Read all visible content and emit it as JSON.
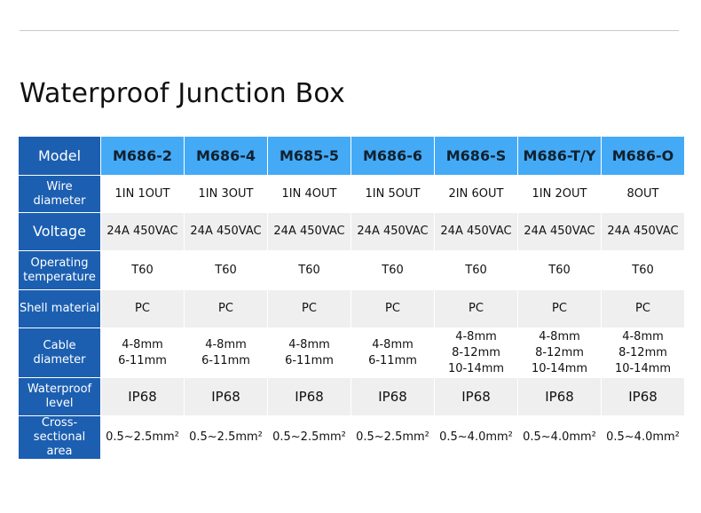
{
  "title": "Waterproof Junction Box",
  "table": {
    "header_label": "Model",
    "models": [
      "M686-2",
      "M686-4",
      "M685-5",
      "M686-6",
      "M686-S",
      "M686-T/Y",
      "M686-O"
    ],
    "rows": [
      {
        "label": [
          "Wire",
          "diameter"
        ],
        "style": "wht",
        "size": "normal",
        "cells": [
          [
            "1IN 1OUT"
          ],
          [
            "1IN 3OUT"
          ],
          [
            "1IN 4OUT"
          ],
          [
            "1IN 5OUT"
          ],
          [
            "2IN 6OUT"
          ],
          [
            "1IN 2OUT"
          ],
          [
            "8OUT"
          ]
        ]
      },
      {
        "label": [
          "Voltage"
        ],
        "style": "alt",
        "size": "normal",
        "big": true,
        "cells": [
          [
            "24A 450VAC"
          ],
          [
            "24A 450VAC"
          ],
          [
            "24A 450VAC"
          ],
          [
            "24A 450VAC"
          ],
          [
            "24A 450VAC"
          ],
          [
            "24A 450VAC"
          ],
          [
            "24A 450VAC"
          ]
        ]
      },
      {
        "label": [
          "Operating",
          "temperature"
        ],
        "style": "wht",
        "size": "normal",
        "cells": [
          [
            "T60"
          ],
          [
            "T60"
          ],
          [
            "T60"
          ],
          [
            "T60"
          ],
          [
            "T60"
          ],
          [
            "T60"
          ],
          [
            "T60"
          ]
        ]
      },
      {
        "label": [
          "Shell material"
        ],
        "style": "alt",
        "size": "normal",
        "cells": [
          [
            "PC"
          ],
          [
            "PC"
          ],
          [
            "PC"
          ],
          [
            "PC"
          ],
          [
            "PC"
          ],
          [
            "PC"
          ],
          [
            "PC"
          ]
        ]
      },
      {
        "label": [
          "Cable diameter"
        ],
        "style": "wht",
        "size": "normal",
        "cells": [
          [
            "4-8mm",
            "6-11mm"
          ],
          [
            "4-8mm",
            "6-11mm"
          ],
          [
            "4-8mm",
            "6-11mm"
          ],
          [
            "4-8mm",
            "6-11mm"
          ],
          [
            "4-8mm",
            "8-12mm",
            "10-14mm"
          ],
          [
            "4-8mm",
            "8-12mm",
            "10-14mm"
          ],
          [
            "4-8mm",
            "8-12mm",
            "10-14mm"
          ]
        ]
      },
      {
        "label": [
          "Waterproof",
          "level"
        ],
        "style": "alt",
        "size": "lg",
        "cells": [
          [
            "IP68"
          ],
          [
            "IP68"
          ],
          [
            "IP68"
          ],
          [
            "IP68"
          ],
          [
            "IP68"
          ],
          [
            "IP68"
          ],
          [
            "IP68"
          ]
        ]
      },
      {
        "label": [
          "Cross-sectional",
          "area"
        ],
        "style": "wht",
        "size": "normal",
        "cells": [
          [
            "0.5~2.5mm²"
          ],
          [
            "0.5~2.5mm²"
          ],
          [
            "0.5~2.5mm²"
          ],
          [
            "0.5~2.5mm²"
          ],
          [
            "0.5~4.0mm²"
          ],
          [
            "0.5~4.0mm²"
          ],
          [
            "0.5~4.0mm²"
          ]
        ]
      }
    ]
  }
}
